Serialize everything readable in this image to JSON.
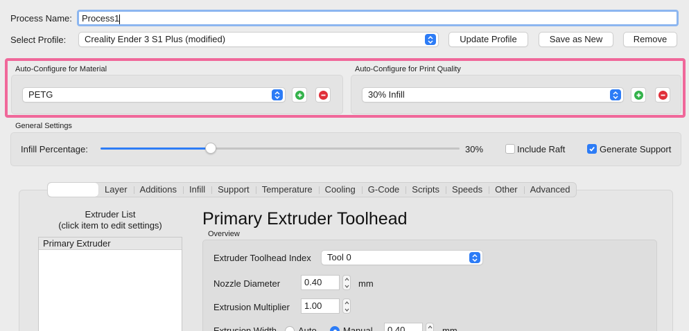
{
  "process": {
    "label": "Process Name:",
    "value": "Process1"
  },
  "profile": {
    "label": "Select Profile:",
    "selected": "Creality Ender 3 S1 Plus (modified)",
    "buttons": {
      "update": "Update Profile",
      "save_new": "Save as New",
      "remove": "Remove"
    }
  },
  "auto_configure": {
    "material": {
      "title": "Auto-Configure for Material",
      "selected": "PETG"
    },
    "quality": {
      "title": "Auto-Configure for Print Quality",
      "selected": "30% Infill"
    },
    "highlight_color": "#f0689a"
  },
  "general": {
    "title": "General Settings",
    "infill_label": "Infill Percentage:",
    "infill_value": "30%",
    "infill_fraction": 0.3,
    "include_raft": {
      "label": "Include Raft",
      "checked": false
    },
    "generate_support": {
      "label": "Generate Support",
      "checked": true
    }
  },
  "tabs": [
    {
      "label": "",
      "active": true
    },
    {
      "label": "Layer"
    },
    {
      "label": "Additions"
    },
    {
      "label": "Infill"
    },
    {
      "label": "Support"
    },
    {
      "label": "Temperature"
    },
    {
      "label": "Cooling"
    },
    {
      "label": "G-Code"
    },
    {
      "label": "Scripts"
    },
    {
      "label": "Speeds"
    },
    {
      "label": "Other"
    },
    {
      "label": "Advanced"
    }
  ],
  "extruder": {
    "list_title_line1": "Extruder List",
    "list_title_line2": "(click item to edit settings)",
    "items": [
      "Primary Extruder"
    ],
    "heading": "Primary Extruder Toolhead",
    "overview_label": "Overview",
    "toolhead_index": {
      "label": "Extruder Toolhead Index",
      "value": "Tool 0"
    },
    "nozzle_diameter": {
      "label": "Nozzle Diameter",
      "value": "0.40",
      "unit": "mm"
    },
    "extrusion_multiplier": {
      "label": "Extrusion Multiplier",
      "value": "1.00"
    },
    "extrusion_width": {
      "label": "Extrusion Width",
      "auto": "Auto",
      "manual": "Manual",
      "value": "0.40",
      "unit": "mm"
    }
  },
  "colors": {
    "accent": "#2d7cf6",
    "add": "#33b24a",
    "remove": "#e0303a"
  }
}
